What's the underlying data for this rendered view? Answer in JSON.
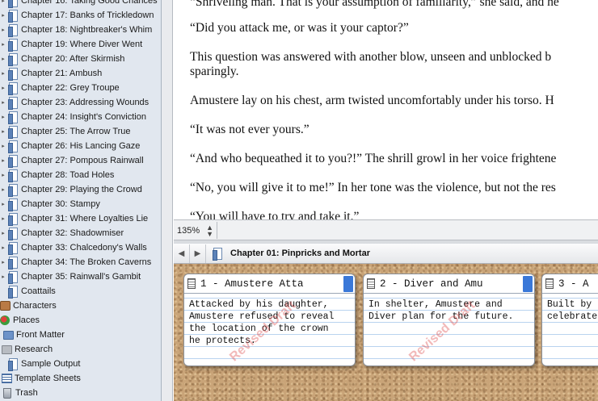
{
  "binder": {
    "items": [
      {
        "kind": "chapter",
        "label": "Chapter 16: Taking Good Chances"
      },
      {
        "kind": "chapter",
        "label": "Chapter 17: Banks of Trickledown"
      },
      {
        "kind": "chapter",
        "label": "Chapter 18: Nightbreaker's Whim"
      },
      {
        "kind": "chapter",
        "label": "Chapter 19: Where Diver Went"
      },
      {
        "kind": "chapter",
        "label": "Chapter 20: After Skirmish"
      },
      {
        "kind": "chapter",
        "label": "Chapter 21: Ambush"
      },
      {
        "kind": "chapter",
        "label": "Chapter 22: Grey Troupe"
      },
      {
        "kind": "chapter",
        "label": "Chapter 23: Addressing Wounds"
      },
      {
        "kind": "chapter",
        "label": "Chapter 24: Insight's Conviction"
      },
      {
        "kind": "chapter",
        "label": "Chapter 25: The Arrow True"
      },
      {
        "kind": "chapter",
        "label": "Chapter 26: His Lancing Gaze"
      },
      {
        "kind": "chapter",
        "label": "Chapter 27: Pompous Rainwall"
      },
      {
        "kind": "chapter",
        "label": "Chapter 28: Toad Holes"
      },
      {
        "kind": "chapter",
        "label": "Chapter 29: Playing the Crowd"
      },
      {
        "kind": "chapter",
        "label": "Chapter 30: Stampy"
      },
      {
        "kind": "chapter",
        "label": "Chapter 31: Where Loyalties Lie"
      },
      {
        "kind": "chapter",
        "label": "Chapter 32: Shadowmiser"
      },
      {
        "kind": "chapter",
        "label": "Chapter 33: Chalcedony's Walls"
      },
      {
        "kind": "chapter",
        "label": "Chapter 34: The Broken Caverns"
      },
      {
        "kind": "chapter",
        "label": "Chapter 35: Rainwall's Gambit"
      },
      {
        "kind": "doc",
        "label": "Coattails"
      },
      {
        "kind": "characters",
        "label": "Characters"
      },
      {
        "kind": "places",
        "label": "Places"
      },
      {
        "kind": "folder",
        "label": "Front Matter"
      },
      {
        "kind": "research",
        "label": "Research"
      },
      {
        "kind": "doc",
        "label": "Sample Output"
      },
      {
        "kind": "sheets",
        "label": "Template Sheets"
      },
      {
        "kind": "trash",
        "label": "Trash"
      }
    ]
  },
  "editor": {
    "paragraphs": [
      "“Shriveling man. That is your assumption of familiarity,” she said, and he",
      "“Did you attack me, or was it your captor?”",
      "This question was answered with another blow, unseen and unblocked b",
      "sparingly.",
      "Amustere lay on his chest, arm twisted uncomfortably under his torso. H",
      "“It was not ever yours.”",
      "“And who bequeathed it to you?!” The shrill growl in her voice frightene",
      "“No, you will give it to me!” In her tone was the violence, but not the res",
      "“You will have to try and take it.”"
    ]
  },
  "footer": {
    "zoom": "135%"
  },
  "header": {
    "title": "Chapter 01: Pinpricks and Mortar"
  },
  "corkboard": {
    "stamp": "Revised Draft",
    "tag_color": "#3a78d8",
    "cards": [
      {
        "title": "1 - Amustere Atta",
        "body": "Attacked by his daughter,\nAmustere refused to reveal\nthe location of the crown\nhe protects."
      },
      {
        "title": "2 - Diver and Amu",
        "body": "In shelter, Amustere and\nDiver plan for the future."
      },
      {
        "title": "3 - A",
        "body": "Built by\ncelebrate"
      }
    ]
  }
}
